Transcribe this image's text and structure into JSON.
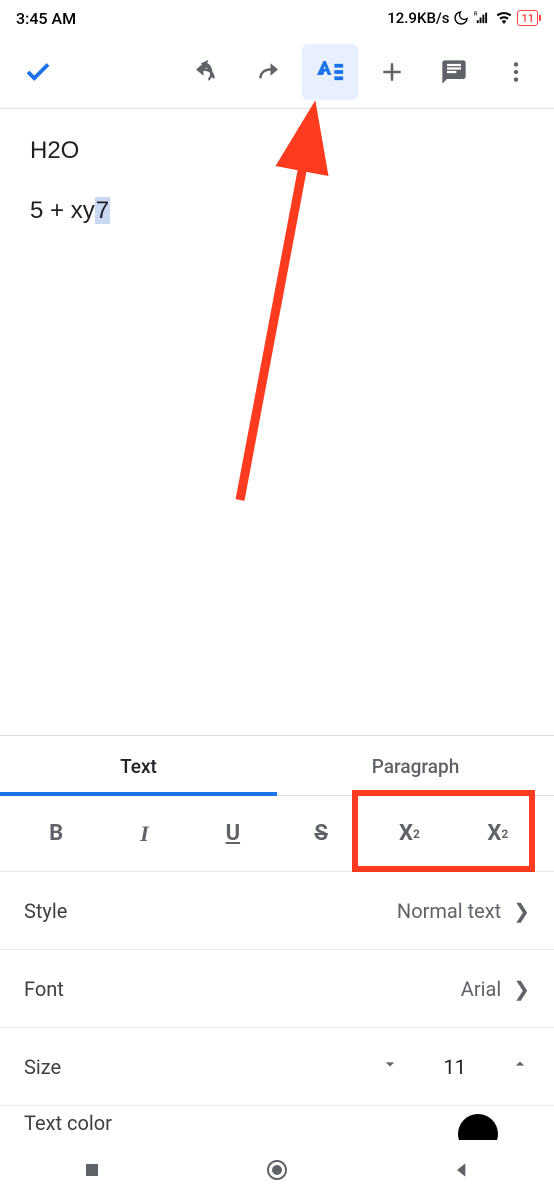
{
  "status": {
    "time": "3:45 AM",
    "net_speed": "12.9KB/s",
    "battery": "11"
  },
  "document": {
    "line1": "H2O",
    "line2_pre": "5 + xy",
    "line2_sel": "7"
  },
  "tabs": {
    "text": "Text",
    "paragraph": "Paragraph"
  },
  "format_buttons": {
    "bold": "B",
    "italic": "I",
    "underline": "U",
    "strike": "S",
    "super_base": "X",
    "super_exp": "2",
    "sub_base": "X",
    "sub_exp": "2"
  },
  "options": {
    "style_label": "Style",
    "style_value": "Normal text",
    "font_label": "Font",
    "font_value": "Arial",
    "size_label": "Size",
    "size_value": "11",
    "textcolor_label": "Text color"
  }
}
